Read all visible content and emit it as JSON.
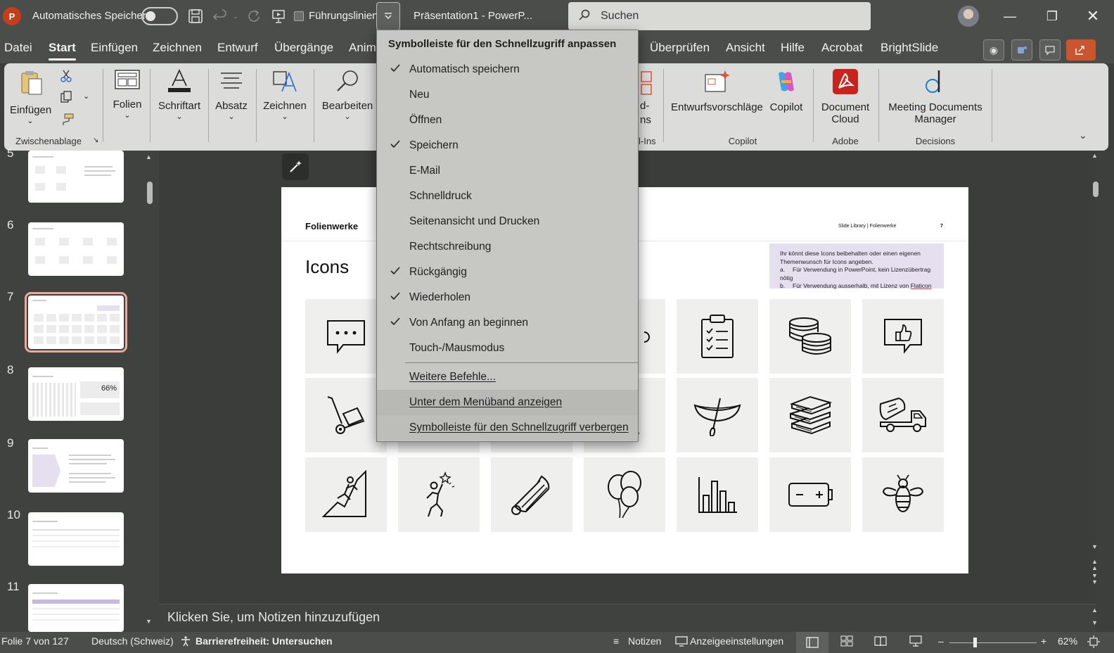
{
  "titlebar": {
    "autosave_label": "Automatisches Speichern",
    "guides_label": "Führungslinien",
    "doc_title": "Präsentation1  -  PowerP...",
    "search_placeholder": "Suchen"
  },
  "menu_tabs": [
    "Datei",
    "Start",
    "Einfügen",
    "Zeichnen",
    "Entwurf",
    "Übergänge",
    "Anim",
    "Überprüfen",
    "Ansicht",
    "Hilfe",
    "Acrobat",
    "BrightSlide"
  ],
  "ribbon": {
    "einfuegen": "Einfügen",
    "zwischenablage": "Zwischenablage",
    "folien": "Folien",
    "schriftart": "Schriftart",
    "absatz": "Absatz",
    "zeichnen": "Zeichnen",
    "bearbeiten": "Bearbeiten",
    "addins_partial_1": "d-",
    "addins_partial_2": "ns",
    "addins_group_partial": "l-Ins",
    "entwurfsvorschlaege": "Entwurfsvorschläge",
    "copilot": "Copilot",
    "copilot_group": "Copilot",
    "document_cloud_1": "Document",
    "document_cloud_2": "Cloud",
    "adobe_group": "Adobe",
    "meeting_1": "Meeting Documents",
    "meeting_2": "Manager",
    "decisions_group": "Decisions"
  },
  "qat_menu": {
    "header": "Symbolleiste für den Schnellzugriff anpassen",
    "items": [
      {
        "label": "Automatisch speichern",
        "checked": true
      },
      {
        "label": "Neu",
        "checked": false
      },
      {
        "label": "Öffnen",
        "checked": false
      },
      {
        "label": "Speichern",
        "checked": true
      },
      {
        "label": "E-Mail",
        "checked": false
      },
      {
        "label": "Schnelldruck",
        "checked": false
      },
      {
        "label": "Seitenansicht und Drucken",
        "checked": false
      },
      {
        "label": "Rechtschreibung",
        "checked": false
      },
      {
        "label": "Rückgängig",
        "checked": true
      },
      {
        "label": "Wiederholen",
        "checked": true
      },
      {
        "label": "Von Anfang an beginnen",
        "checked": true
      },
      {
        "label": "Touch-/Mausmodus",
        "checked": false
      }
    ],
    "more": "Weitere Befehle...",
    "below_ribbon": "Unter dem Menüband anzeigen",
    "hide": "Symbolleiste für den Schnellzugriff verbergen"
  },
  "slides": [
    "5",
    "6",
    "7",
    "8",
    "9",
    "10",
    "11"
  ],
  "thumb_text": {
    "s8_pct": "66%"
  },
  "slide": {
    "brand": "Folienwerke",
    "header_right": "Slide Library | Folienwerke",
    "page_num": "7",
    "title": "Icons",
    "note_line1": "Ihr könnt diese Icons beibehalten oder einen eigenen",
    "note_line2": "Themenwunsch für Icons angeben.",
    "note_a_letter": "a.",
    "note_a": "Für Verwendung in PowerPoint, kein Lizenzübertrag nötig",
    "note_b_letter": "b.",
    "note_b": "Für Verwendung ausserhalb, mit Lizenz von ",
    "note_b_link": "Flaticon"
  },
  "notes_placeholder": "Klicken Sie, um Notizen hinzuzufügen",
  "status": {
    "slide_of": "Folie 7 von 127",
    "language": "Deutsch (Schweiz)",
    "accessibility": "Barrierefreiheit: Untersuchen",
    "notes": "Notizen",
    "display_settings": "Anzeigeeinstellungen",
    "zoom": "62%"
  },
  "colors": {
    "accent_red": "#c43e1c",
    "selected_thumb": "#f0a79a",
    "note_box": "#e6dff0"
  }
}
